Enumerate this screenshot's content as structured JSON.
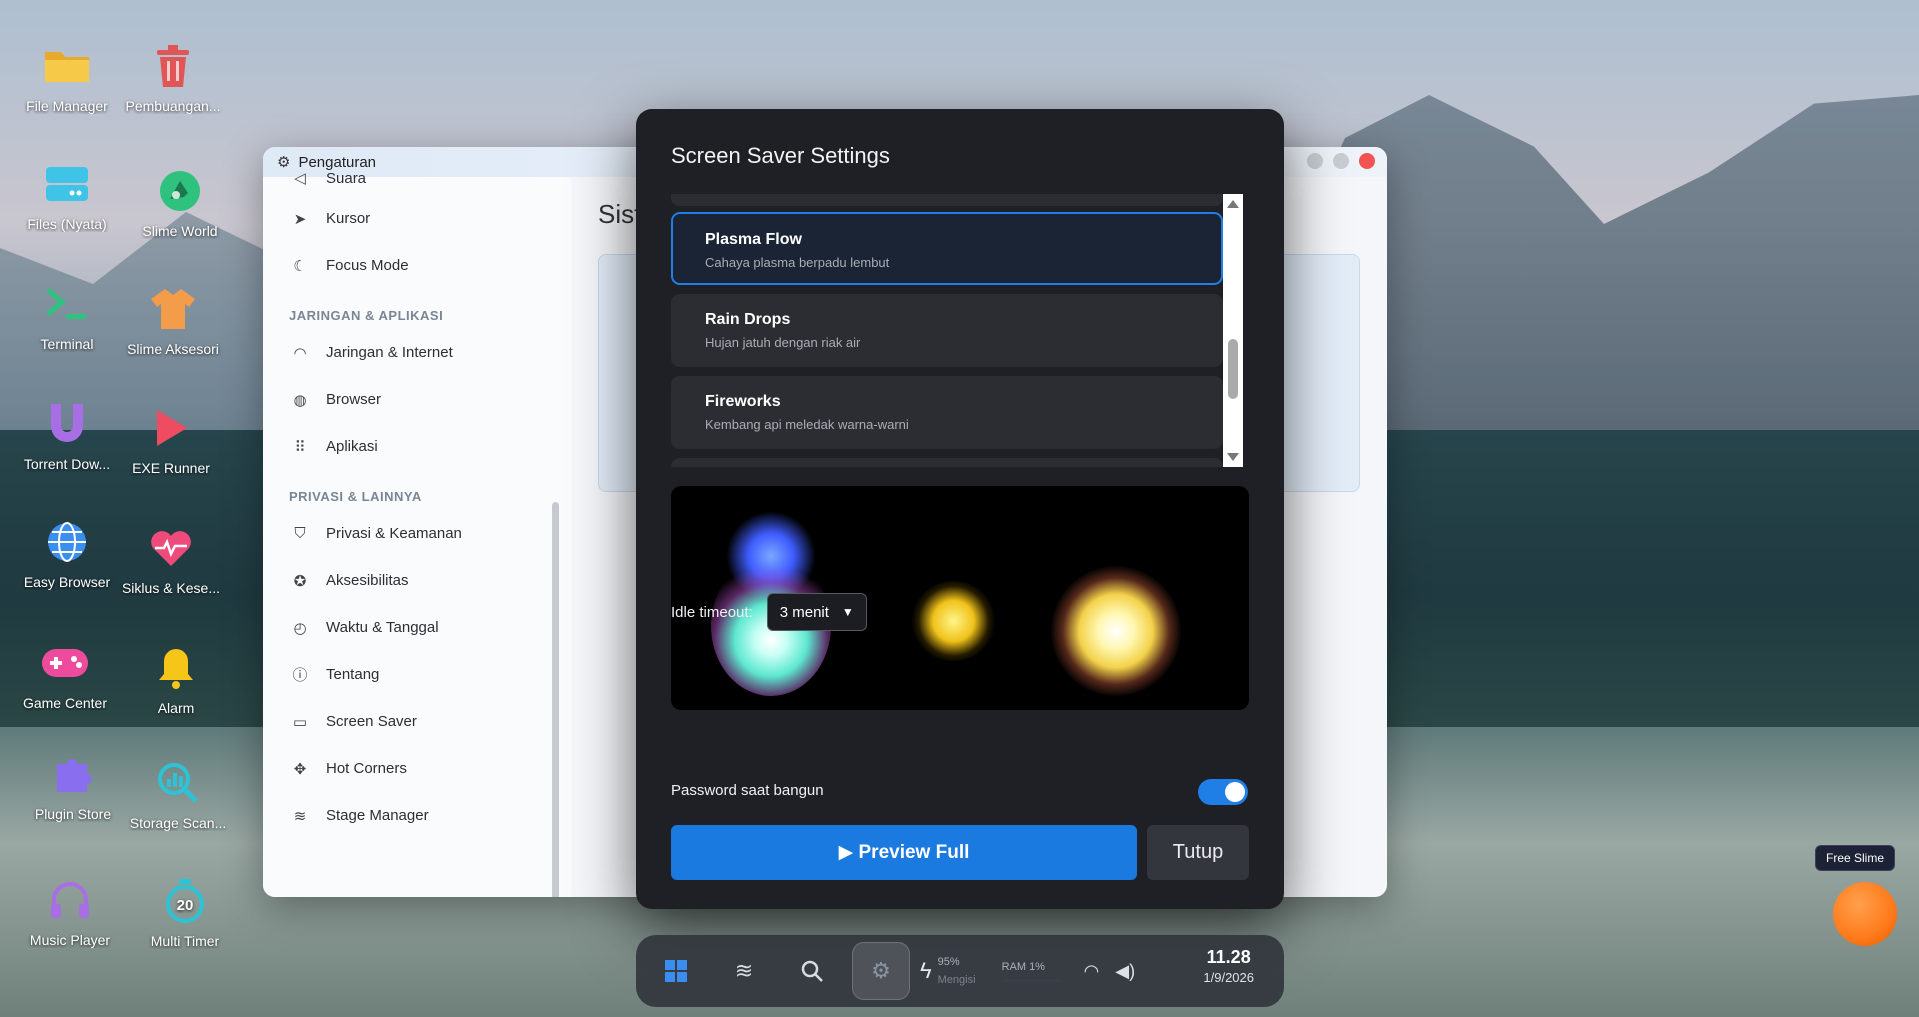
{
  "desktop_icons": [
    {
      "label": "File Manager",
      "icon": "folder-icon",
      "color": "#f5c242"
    },
    {
      "label": "Pembuangan...",
      "icon": "trash-icon",
      "color": "#e05555"
    },
    {
      "label": "Files (Nyata)",
      "icon": "drive-icon",
      "color": "#3fc4e8"
    },
    {
      "label": "Slime World",
      "icon": "slime-world-icon",
      "color": "#2ec27e"
    },
    {
      "label": "Terminal",
      "icon": "terminal-icon",
      "color": "#2ec27e"
    },
    {
      "label": "Slime Aksesori",
      "icon": "shirt-icon",
      "color": "#f39c4a"
    },
    {
      "label": "Torrent Dow...",
      "icon": "magnet-icon",
      "color": "#a86ee6"
    },
    {
      "label": "EXE Runner",
      "icon": "play-icon",
      "color": "#ef4b61"
    },
    {
      "label": "Easy Browser",
      "icon": "globe-icon",
      "color": "#3a8ef0"
    },
    {
      "label": "Siklus & Kese...",
      "icon": "heart-pulse-icon",
      "color": "#ef4b7a"
    },
    {
      "label": "Game Center",
      "icon": "gamepad-icon",
      "color": "#ef4b9c"
    },
    {
      "label": "Alarm",
      "icon": "bell-icon",
      "color": "#f5c518"
    },
    {
      "label": "Plugin Store",
      "icon": "puzzle-icon",
      "color": "#8a6ef0"
    },
    {
      "label": "Storage Scan...",
      "icon": "chart-search-icon",
      "color": "#2ec2d6"
    },
    {
      "label": "Music Player",
      "icon": "headphones-icon",
      "color": "#a86ee6"
    },
    {
      "label": "Multi Timer",
      "icon": "timer-icon",
      "color": "#2ec2d6"
    }
  ],
  "settings_window": {
    "title": "Pengaturan",
    "partial_top_item": "Suara",
    "items_group0": [
      {
        "label": "Kursor",
        "icon": "cursor-icon",
        "glyph": "➤"
      },
      {
        "label": "Focus Mode",
        "icon": "moon-icon",
        "glyph": "☾"
      }
    ],
    "section1": "JARINGAN & APLIKASI",
    "items_group1": [
      {
        "label": "Jaringan & Internet",
        "icon": "wifi-icon",
        "glyph": "◠"
      },
      {
        "label": "Browser",
        "icon": "globe-icon",
        "glyph": "◍"
      },
      {
        "label": "Aplikasi",
        "icon": "apps-grid-icon",
        "glyph": "⠿"
      }
    ],
    "section2": "PRIVASI & LAINNYA",
    "items_group2": [
      {
        "label": "Privasi & Keamanan",
        "icon": "shield-icon",
        "glyph": "⛉"
      },
      {
        "label": "Aksesibilitas",
        "icon": "accessibility-icon",
        "glyph": "✪"
      },
      {
        "label": "Waktu & Tanggal",
        "icon": "clock-icon",
        "glyph": "◴"
      },
      {
        "label": "Tentang",
        "icon": "info-icon",
        "glyph": "ⓘ"
      },
      {
        "label": "Screen Saver",
        "icon": "monitor-icon",
        "glyph": "▭"
      },
      {
        "label": "Hot Corners",
        "icon": "move-icon",
        "glyph": "✥"
      },
      {
        "label": "Stage Manager",
        "icon": "layers-icon",
        "glyph": "≋"
      }
    ],
    "main_title_partial": "Sist"
  },
  "screen_saver": {
    "title": "Screen Saver Settings",
    "options": [
      {
        "name": "Plasma Flow",
        "desc": "Cahaya plasma berpadu lembut",
        "selected": true
      },
      {
        "name": "Rain Drops",
        "desc": "Hujan jatuh dengan riak air",
        "selected": false
      },
      {
        "name": "Fireworks",
        "desc": "Kembang api meledak warna-warni",
        "selected": false
      }
    ],
    "idle_label": "Idle timeout:",
    "idle_value": "3 menit",
    "password_label": "Password saat bangun",
    "password_enabled": true,
    "preview_button": "▶ Preview Full",
    "close_button": "Tutup"
  },
  "taskbar": {
    "battery_percent": "95%",
    "battery_status": "Mengisi",
    "ram": "RAM 1%",
    "time": "11.28",
    "date": "1/9/2026"
  },
  "free_slime": "Free Slime",
  "colors": {
    "accent": "#1b7ae0",
    "dialog_bg": "#1e2026"
  }
}
